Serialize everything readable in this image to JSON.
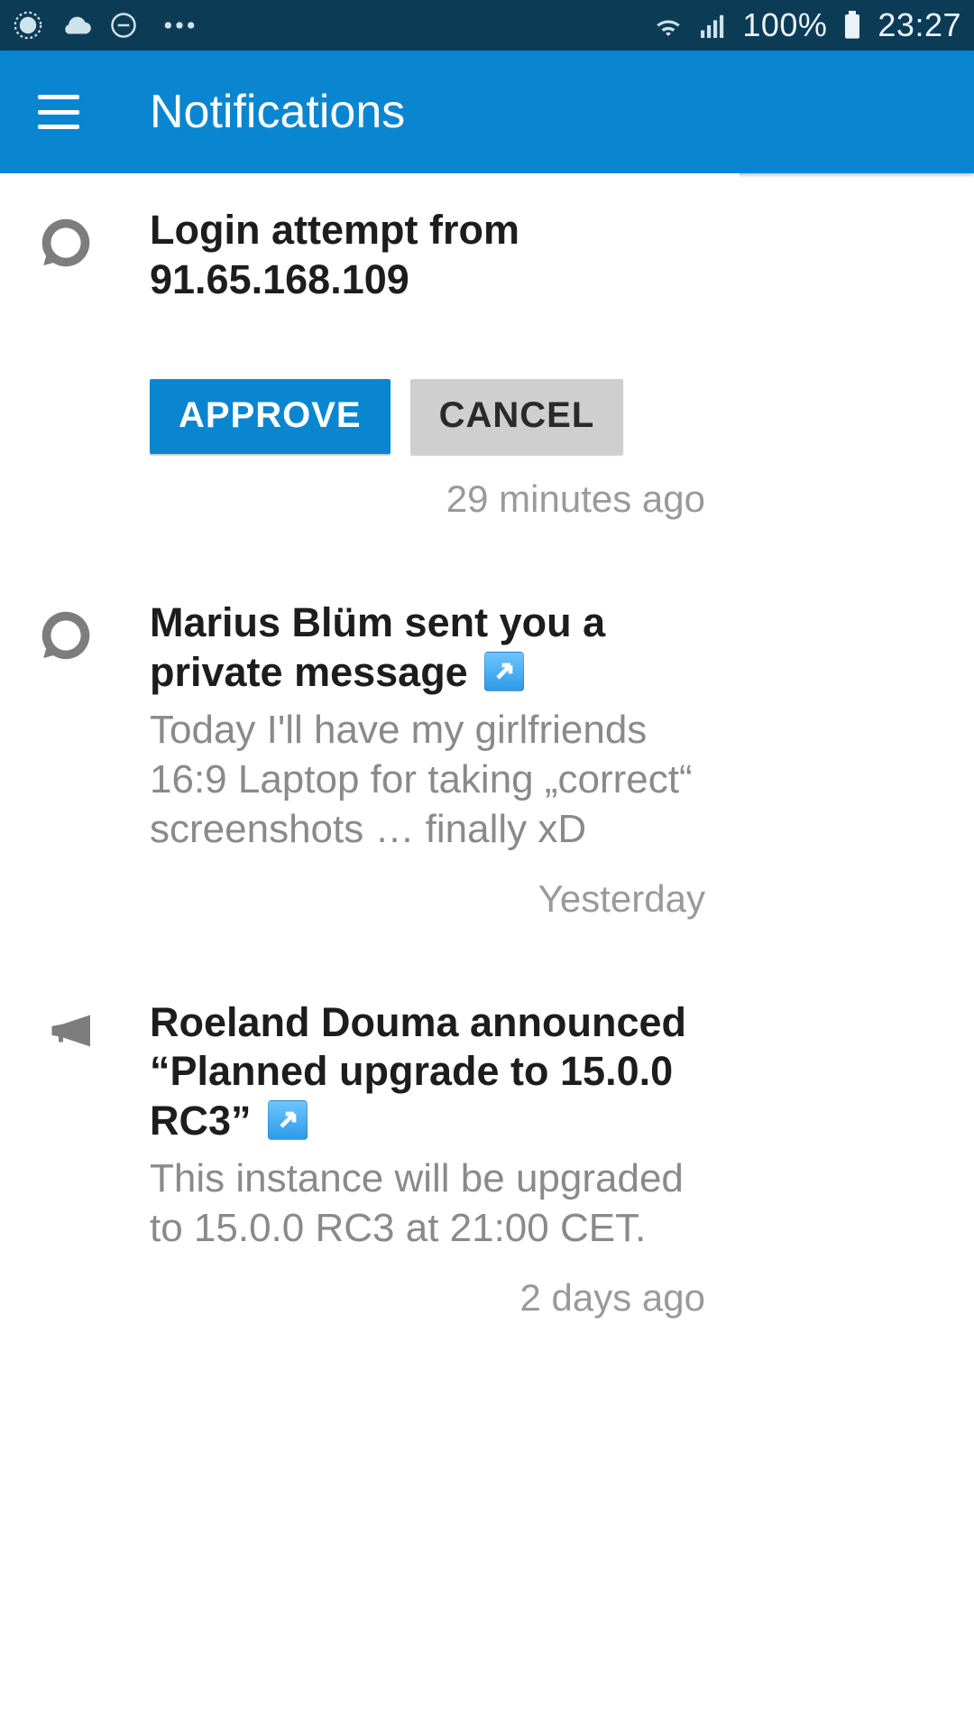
{
  "statusbar": {
    "battery_pct": "100%",
    "time": "23:27"
  },
  "appbar": {
    "title": "Notifications"
  },
  "notifications": [
    {
      "icon": "bubble",
      "title_a": "Login attempt from",
      "title_b": "91.65.168.109",
      "has_link": false,
      "snippet": "",
      "buttons": {
        "approve": "APPROVE",
        "cancel": "CANCEL"
      },
      "time": "29 minutes ago"
    },
    {
      "icon": "bubble",
      "title_a": "Marius Blüm sent you a private message",
      "title_b": "",
      "has_link": true,
      "snippet": "Today I'll have my girlfriends 16:9 Laptop for taking „correct“ screenshots … finally xD",
      "buttons": null,
      "time": "Yesterday"
    },
    {
      "icon": "megaphone",
      "title_a": "Roeland Douma announced “Planned upgrade to 15.0.0 RC3”",
      "title_b": "",
      "has_link": true,
      "snippet": "This instance will be upgraded to 15.0.0 RC3 at 21:00 CET.",
      "buttons": null,
      "time": "2 days ago"
    }
  ],
  "colors": {
    "status_bg": "#0c3b56",
    "primary": "#0a86d1",
    "text": "#1d1d1d",
    "muted": "#8a8a8a"
  }
}
